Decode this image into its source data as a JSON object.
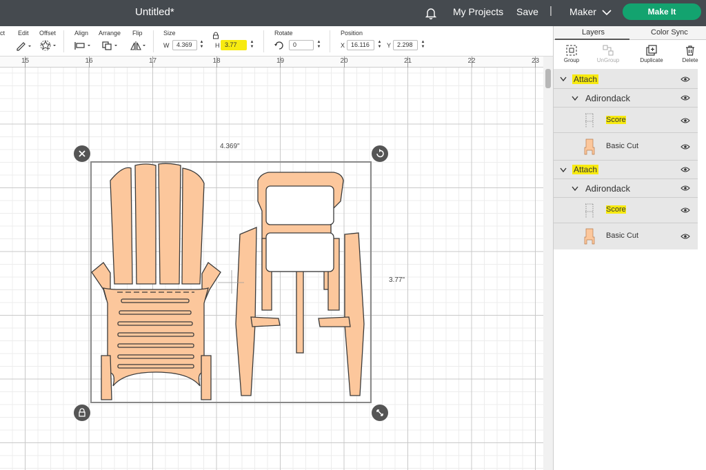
{
  "header": {
    "title": "Untitled*",
    "my_projects": "My Projects",
    "save": "Save",
    "separator": "|",
    "machine": "Maker",
    "make_it": "Make It"
  },
  "toolbar": {
    "select_label": "ct",
    "edit_label": "Edit",
    "offset_label": "Offset",
    "align_label": "Align",
    "arrange_label": "Arrange",
    "flip_label": "Flip",
    "size_label": "Size",
    "w_label": "W",
    "w_value": "4.369",
    "h_label": "H",
    "h_value": "3.77",
    "rotate_label": "Rotate",
    "rotate_value": "0",
    "position_label": "Position",
    "x_label": "X",
    "x_value": "16.116",
    "y_label": "Y",
    "y_value": "2.298"
  },
  "ruler": {
    "marks": [
      "15",
      "16",
      "17",
      "18",
      "19",
      "20",
      "21",
      "22",
      "23"
    ]
  },
  "canvas": {
    "width_dim": "4.369\"",
    "height_dim": "3.77\""
  },
  "panel": {
    "tab_layers": "Layers",
    "tab_color_sync": "Color Sync",
    "group": "Group",
    "ungroup": "UnGroup",
    "duplicate": "Duplicate",
    "delete": "Delete",
    "layers": [
      {
        "attach": "Attach",
        "group": "Adirondack",
        "score": "Score",
        "cut": "Basic Cut"
      },
      {
        "attach": "Attach",
        "group": "Adirondack",
        "score": "Score",
        "cut": "Basic Cut"
      }
    ]
  },
  "colors": {
    "topbar": "#454a4f",
    "make_it": "#13a36f",
    "material": "#fcc79c",
    "highlight": "#f7ea10"
  }
}
